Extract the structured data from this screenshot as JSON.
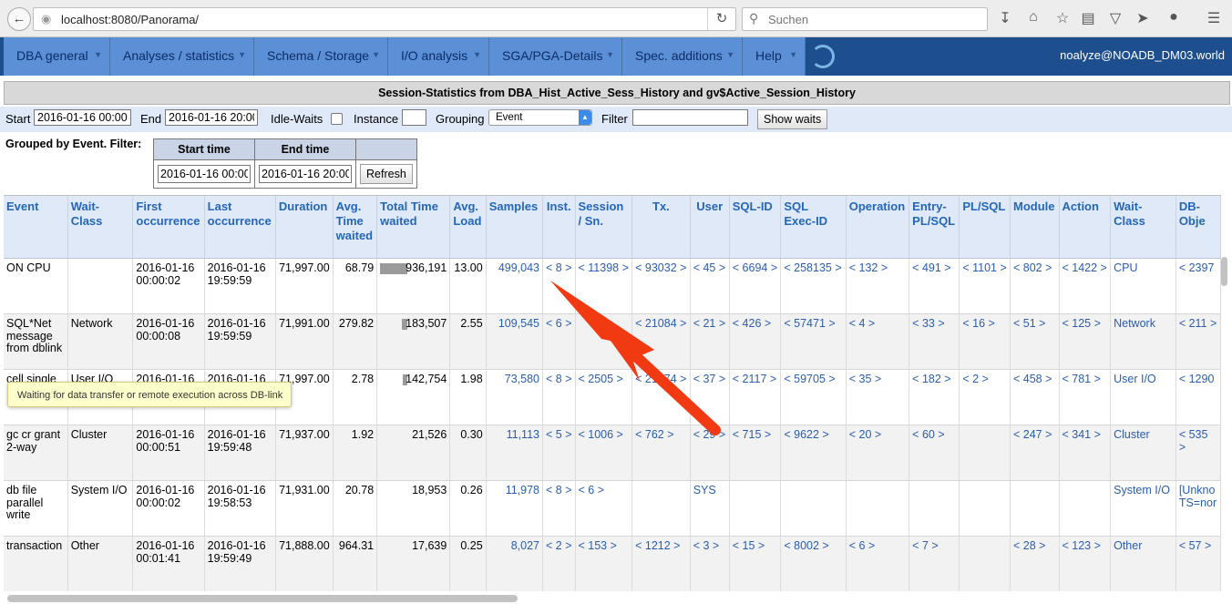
{
  "browser": {
    "url_host": "localhost",
    "url_rest": ":8080/Panorama/",
    "search_placeholder": "Suchen"
  },
  "menu": {
    "items": [
      {
        "label": "DBA general"
      },
      {
        "label": "Analyses / statistics"
      },
      {
        "label": "Schema / Storage"
      },
      {
        "label": "I/O analysis"
      },
      {
        "label": "SGA/PGA-Details"
      },
      {
        "label": "Spec. additions"
      },
      {
        "label": "Help"
      }
    ],
    "user": "noalyze@NOADB_DM03.world"
  },
  "title": "Session-Statistics from DBA_Hist_Active_Sess_History and gv$Active_Session_History",
  "filter": {
    "start_label": "Start",
    "start_value": "2016-01-16 00:00",
    "end_label": "End",
    "end_value": "2016-01-16 20:00",
    "idle_label": "Idle-Waits",
    "instance_label": "Instance",
    "instance_value": "",
    "grouping_label": "Grouping",
    "grouping_value": "Event",
    "filter_label": "Filter",
    "filter_value": "",
    "show_button": "Show waits"
  },
  "grouped": {
    "label": "Grouped by Event. Filter:",
    "start_header": "Start time",
    "end_header": "End time",
    "start_value": "2016-01-16 00:00",
    "end_value": "2016-01-16 20:00",
    "refresh": "Refresh"
  },
  "grid": {
    "columns": [
      "Event",
      "Wait-Class",
      "First occurrence",
      "Last occurrence",
      "Duration",
      "Avg. Time waited",
      "Total Time waited",
      "Avg. Load",
      "Samples",
      "Inst.",
      "Session / Sn.",
      "Tx.",
      "User",
      "SQL-ID",
      "SQL Exec-ID",
      "Operation",
      "Entry-PL/SQL",
      "PL/SQL",
      "Module",
      "Action",
      "Wait-Class",
      "DB-Obje"
    ],
    "rows": [
      {
        "event": "ON CPU",
        "wait_class": "",
        "first": "2016-01-16 00:00:02",
        "last": "2016-01-16 19:59:59",
        "duration": "71,997.00",
        "avg_time": "68.79",
        "total_time": "936,191",
        "total_bar": 1.0,
        "avg_load": "13.00",
        "samples": "499,043",
        "inst": "< 8 >",
        "session": "< 11398 >",
        "tx": "< 93032 >",
        "user": "< 45 >",
        "sql_id": "< 6694 >",
        "exec_id": "< 258135 >",
        "operation": "< 132 >",
        "entry_plsql": "< 491 >",
        "plsql": "< 1101 >",
        "module": "< 802 >",
        "action": "< 1422 >",
        "wait_class2": "CPU",
        "db_obj": "< 2397"
      },
      {
        "event": "SQL*Net message from dblink",
        "wait_class": "Network",
        "first": "2016-01-16 00:00:08",
        "last": "2016-01-16 19:59:59",
        "duration": "71,991.00",
        "avg_time": "279.82",
        "total_time": "183,507",
        "total_bar": 0.2,
        "avg_load": "2.55",
        "samples": "109,545",
        "inst": "< 6 >",
        "session": "",
        "tx": "< 21084 >",
        "user": "< 21 >",
        "sql_id": "< 426 >",
        "exec_id": "< 57471 >",
        "operation": "< 4 >",
        "entry_plsql": "< 33 >",
        "plsql": "< 16 >",
        "module": "< 51 >",
        "action": "< 125 >",
        "wait_class2": "Network",
        "db_obj": "< 211 >"
      },
      {
        "event": "cell single ... read",
        "wait_class": "User I/O",
        "first": "2016-01-16",
        "last": "2016-01-16",
        "duration": "71,997.00",
        "avg_time": "2.78",
        "total_time": "142,754",
        "total_bar": 0.15,
        "avg_load": "1.98",
        "samples": "73,580",
        "inst": "< 8 >",
        "session": "< 2505 >",
        "tx": "< 21774 >",
        "user": "< 37 >",
        "sql_id": "< 2117 >",
        "exec_id": "< 59705 >",
        "operation": "< 35 >",
        "entry_plsql": "< 182 >",
        "plsql": "< 2 >",
        "module": "< 458 >",
        "action": "< 781 >",
        "wait_class2": "User I/O",
        "db_obj": "< 1290"
      },
      {
        "event": "gc cr grant 2-way",
        "wait_class": "Cluster",
        "first": "2016-01-16 00:00:51",
        "last": "2016-01-16 19:59:48",
        "duration": "71,937.00",
        "avg_time": "1.92",
        "total_time": "21,526",
        "total_bar": 0,
        "avg_load": "0.30",
        "samples": "11,113",
        "inst": "< 5 >",
        "session": "< 1006 >",
        "tx": "< 762 >",
        "user": "< 29 >",
        "sql_id": "< 715 >",
        "exec_id": "< 9622 >",
        "operation": "< 20 >",
        "entry_plsql": "< 60 >",
        "plsql": "",
        "module": "< 247 >",
        "action": "< 341 >",
        "wait_class2": "Cluster",
        "db_obj": "< 535 >"
      },
      {
        "event": "db file parallel write",
        "wait_class": "System I/O",
        "first": "2016-01-16 00:00:02",
        "last": "2016-01-16 19:58:53",
        "duration": "71,931.00",
        "avg_time": "20.78",
        "total_time": "18,953",
        "total_bar": 0,
        "avg_load": "0.26",
        "samples": "11,978",
        "inst": "< 8 >",
        "session": "< 6 >",
        "tx": "",
        "user": "SYS",
        "sql_id": "",
        "exec_id": "",
        "operation": "",
        "entry_plsql": "",
        "plsql": "",
        "module": "",
        "action": "",
        "wait_class2": "System I/O",
        "db_obj": "[Unkno TS=nor"
      },
      {
        "event": "transaction",
        "wait_class": "Other",
        "first": "2016-01-16 00:01:41",
        "last": "2016-01-16 19:59:49",
        "duration": "71,888.00",
        "avg_time": "964.31",
        "total_time": "17,639",
        "total_bar": 0,
        "avg_load": "0.25",
        "samples": "8,027",
        "inst": "< 2 >",
        "session": "< 153 >",
        "tx": "< 1212 >",
        "user": "< 3 >",
        "sql_id": "< 15 >",
        "exec_id": "< 8002 >",
        "operation": "< 6 >",
        "entry_plsql": "< 7 >",
        "plsql": "",
        "module": "< 28 >",
        "action": "< 123 >",
        "wait_class2": "Other",
        "db_obj": "< 57 >"
      }
    ]
  },
  "tooltip": "Waiting for data transfer or remote execution across DB-link",
  "colors": {
    "menu_bg": "#5b8fd6",
    "header_text": "#2467b9",
    "link": "#2a5db0",
    "arrow": "#f23a12"
  }
}
